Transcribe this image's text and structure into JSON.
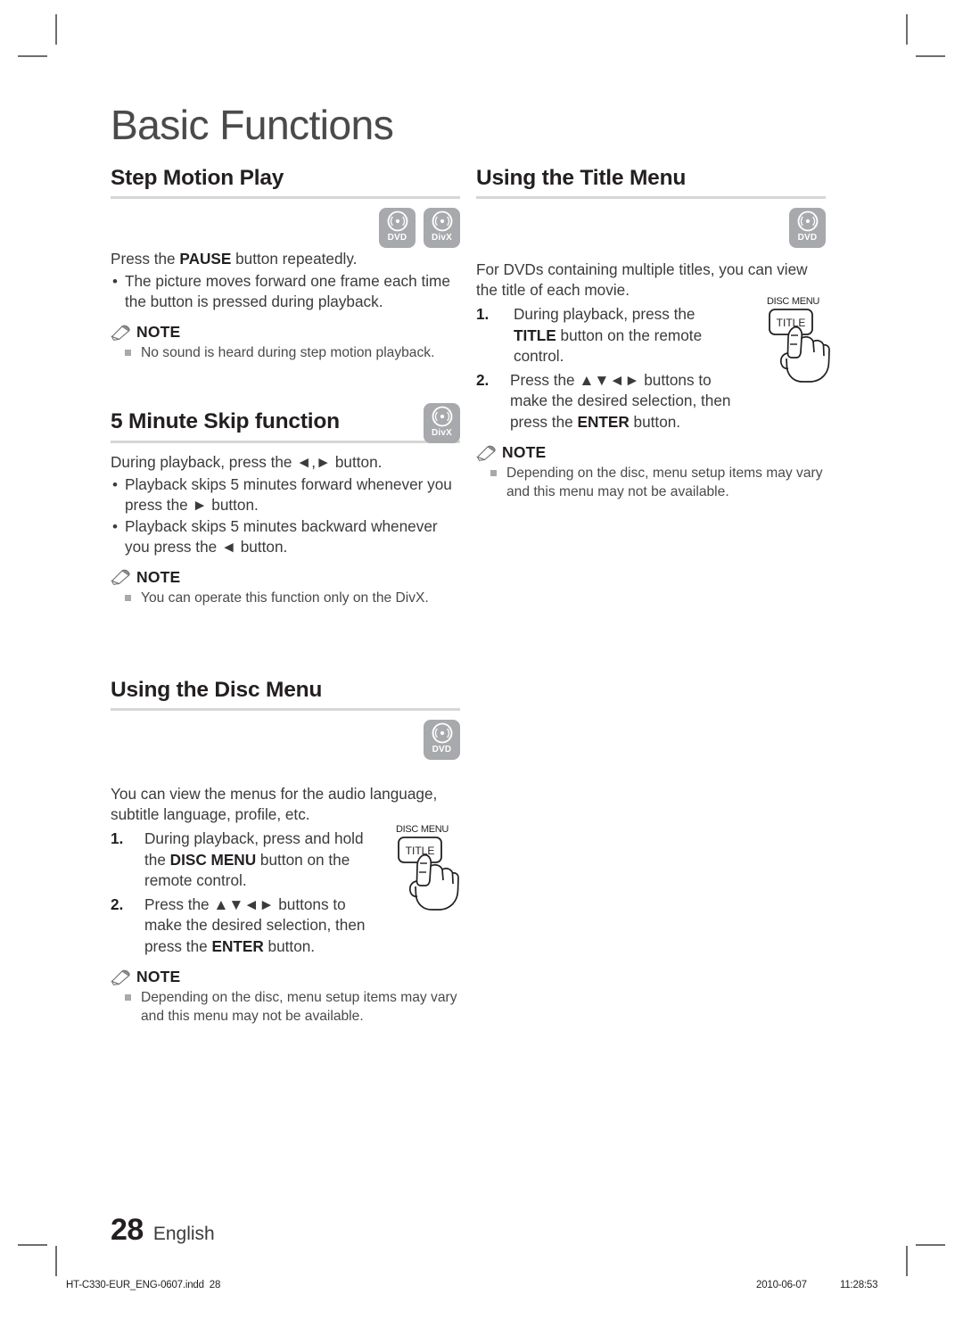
{
  "document": {
    "chapter_title": "Basic Functions",
    "page_number": "28",
    "language": "English"
  },
  "print_footer": {
    "filename": "HT-C330-EUR_ENG-0607.indd",
    "page": "28",
    "date": "2010-06-07",
    "time": "11:28:53"
  },
  "badges": {
    "dvd": "DVD",
    "divx": "DivX"
  },
  "note_label": "NOTE",
  "left_column": {
    "step_motion": {
      "title": "Step Motion Play",
      "badges": [
        "DVD",
        "DivX"
      ],
      "intro_prefix": "Press the ",
      "intro_bold": "PAUSE",
      "intro_suffix": " button repeatedly.",
      "bullets": [
        "The picture moves forward one frame each time the button is pressed during playback."
      ],
      "notes": [
        "No sound is heard during step motion playback."
      ]
    },
    "skip_function": {
      "title": "5 Minute Skip function",
      "badges": [
        "DivX"
      ],
      "intro": "During playback, press the ◄,► button.",
      "bullets": [
        "Playback skips 5 minutes forward whenever you press the ► button.",
        "Playback skips 5 minutes backward whenever you press the ◄ button."
      ],
      "notes": [
        "You can operate this function only on the DivX."
      ]
    },
    "disc_menu": {
      "title": "Using the Disc Menu",
      "badges": [
        "DVD"
      ],
      "intro": "You can view the menus for the audio language, subtitle language, profile, etc.",
      "steps": [
        {
          "num": "1.",
          "text_before": "During playback, press and hold the ",
          "bold": "DISC MENU",
          "text_after": " button on the remote control."
        },
        {
          "num": "2.",
          "text_before": "Press the ▲▼◄► buttons to make the desired selection, then press the ",
          "bold": "ENTER",
          "text_after": " button."
        }
      ],
      "illustration": {
        "caption": "DISC MENU",
        "button_label": "TITLE"
      },
      "notes": [
        "Depending on the disc, menu setup items may vary and this menu may not be available."
      ]
    }
  },
  "right_column": {
    "title_menu": {
      "title": "Using the Title Menu",
      "badges": [
        "DVD"
      ],
      "intro": "For DVDs containing multiple titles, you can view the title of each movie.",
      "steps": [
        {
          "num": "1.",
          "text_before": "During playback, press the ",
          "bold": "TITLE",
          "text_after": " button on the remote control."
        },
        {
          "num": "2.",
          "text_before": "Press the ▲▼◄► buttons to make the desired selection, then press the ",
          "bold": "ENTER",
          "text_after": " button."
        }
      ],
      "illustration": {
        "caption": "DISC MENU",
        "button_label": "TITLE"
      },
      "notes": [
        "Depending on the disc, menu setup items may vary and this menu may not be available."
      ]
    }
  },
  "colors": {
    "badge_gray": "#a7a9ac",
    "rule_gray": "#d6d6d6",
    "text_dark": "#231f20",
    "text_body": "#3b3b3b"
  }
}
